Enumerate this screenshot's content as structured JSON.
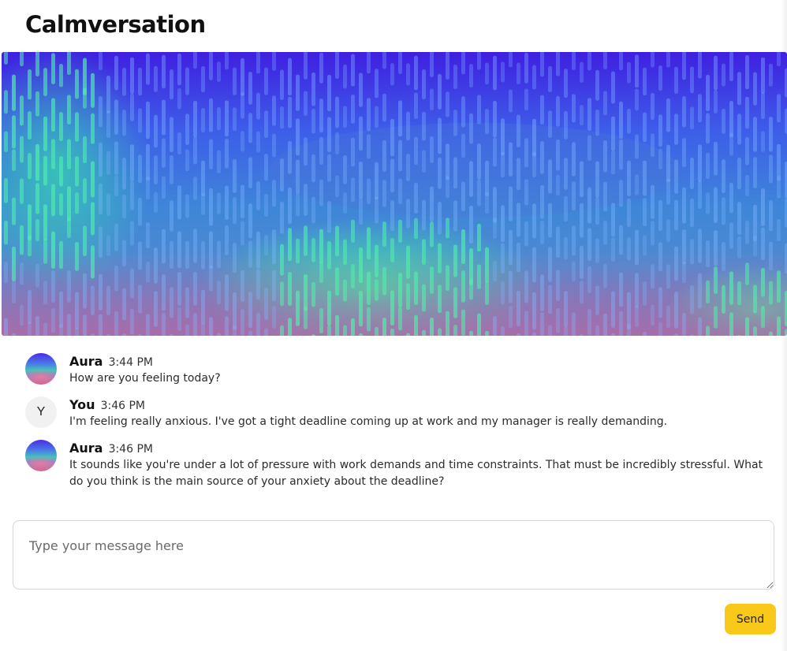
{
  "app": {
    "title": "Calmversation"
  },
  "theme": {
    "accent": "#f8c81a",
    "banner_top": "#3f1fe0",
    "banner_mid": "#3e86d8",
    "banner_glow": "#3cf0a0"
  },
  "banner": {
    "icon": "wave-visualizer"
  },
  "messages": [
    {
      "author": "Aura",
      "time": "3:44 PM",
      "avatar": "aura-gradient",
      "text": "How are you feeling today?"
    },
    {
      "author": "You",
      "time": "3:46 PM",
      "avatar_initial": "Y",
      "text": "I'm feeling really anxious. I've got a tight deadline coming up at work and my manager is really demanding."
    },
    {
      "author": "Aura",
      "time": "3:46 PM",
      "avatar": "aura-gradient",
      "text": "It sounds like you're under a lot of pressure with work demands and time constraints. That must be incredibly stressful. What do you think is the main source of your anxiety about the deadline?"
    }
  ],
  "composer": {
    "placeholder": "Type your message here",
    "value": ""
  },
  "actions": {
    "send_label": "Send"
  }
}
